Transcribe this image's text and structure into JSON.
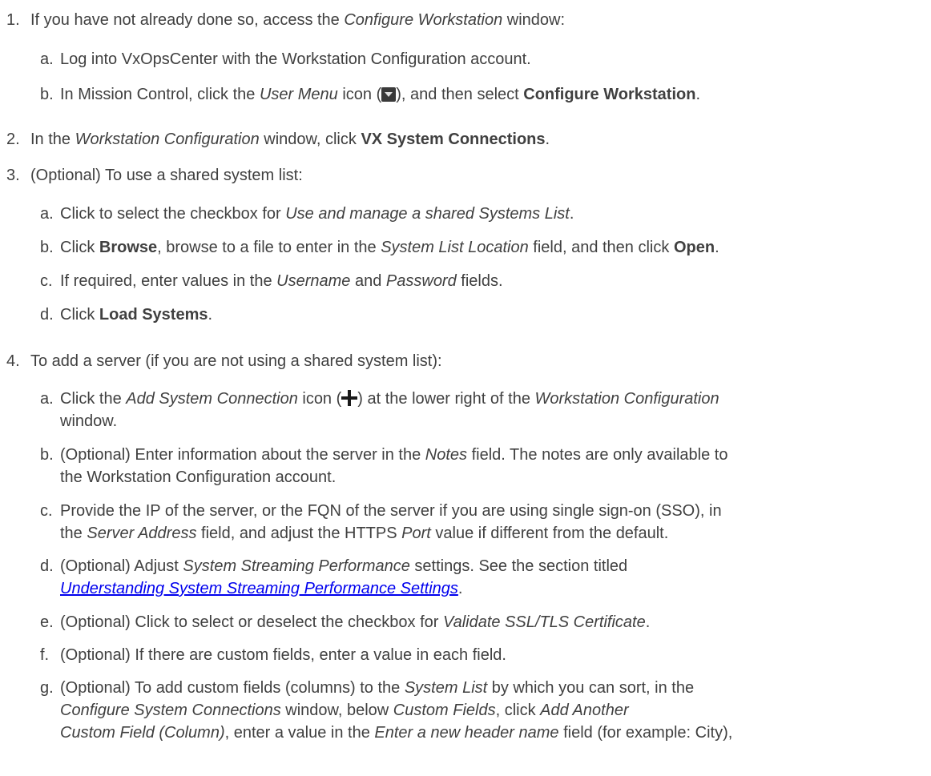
{
  "steps": [
    {
      "num": "1.",
      "pre": "If you have not already done so, access the ",
      "em": "Configure Workstation",
      "post": " window:",
      "subs": [
        {
          "letter": "a.",
          "text": "Log into VxOpsCenter with the Workstation Configuration account."
        },
        {
          "letter": "b.",
          "t1": "In Mission Control, click the ",
          "em1": "User Menu",
          "t2": " icon (",
          "t3": "), and then select ",
          "b1": "Configure Workstation",
          "t4": "."
        }
      ]
    },
    {
      "num": "2.",
      "pre": "In the ",
      "em": "Workstation Configuration",
      "mid": " window, click ",
      "b": "VX System Connections",
      "post": "."
    },
    {
      "num": "3.",
      "text": "(Optional) To use a shared system list:",
      "subs": [
        {
          "letter": "a.",
          "t1": "Click to select the checkbox for ",
          "em1": "Use and manage a shared Systems List",
          "t2": "."
        },
        {
          "letter": "b.",
          "t1": "Click ",
          "b1": "Browse",
          "t2": ", browse to a file to enter in the ",
          "em1": "System List Location",
          "t3": " field, and then click ",
          "b2": "Open",
          "t4": "."
        },
        {
          "letter": "c.",
          "t1": "If required, enter values in the ",
          "em1": "Username",
          "t2": " and ",
          "em2": "Password",
          "t3": " fields."
        },
        {
          "letter": "d.",
          "t1": "Click ",
          "b1": "Load Systems",
          "t2": "."
        }
      ]
    },
    {
      "num": "4.",
      "text": "To add a server (if you are not using a shared system list):",
      "subs": [
        {
          "letter": "a.",
          "t1": "Click the ",
          "em1": "Add System Connection",
          "t2": " icon (",
          "t3": ") at the lower right of the ",
          "em2": "Workstation Configuration",
          "t4": "window."
        },
        {
          "letter": "b.",
          "t1": "(Optional) Enter information about the server in the ",
          "em1": "Notes",
          "t2": " field. The notes are only available to",
          "t3": "the Workstation Configuration account."
        },
        {
          "letter": "c.",
          "t1": "Provide the IP of the server, or the FQN of the server if you are using single sign-on (SSO), in",
          "t2": "the ",
          "em1": "Server Address",
          "t3": " field, and adjust the HTTPS ",
          "em2": "Port",
          "t4": " value if different from the default."
        },
        {
          "letter": "d.",
          "t1": "(Optional) Adjust ",
          "em1": "System Streaming Performance",
          "t2": " settings. See the section titled",
          "link": "Understanding System Streaming Performance Settings",
          "t3": "."
        },
        {
          "letter": "e.",
          "t1": "(Optional) Click to select or deselect the checkbox for ",
          "em1": "Validate SSL/TLS Certificate",
          "t2": "."
        },
        {
          "letter": "f.",
          "t1": "(Optional) If there are custom fields, enter a value in each field."
        },
        {
          "letter": "g.",
          "t1": "(Optional) To add custom fields (columns) to the ",
          "em1": "System List",
          "t2": " by which you can sort, in the",
          "em2": "Configure System Connections",
          "t3": " window, below ",
          "em3": "Custom Fields",
          "t4": ", click ",
          "em4": "Add Another",
          "em5": "Custom Field (Column)",
          "t5": ", enter a value in the ",
          "em6": "Enter a new header name",
          "t6": " field (for example: City),"
        }
      ]
    }
  ]
}
